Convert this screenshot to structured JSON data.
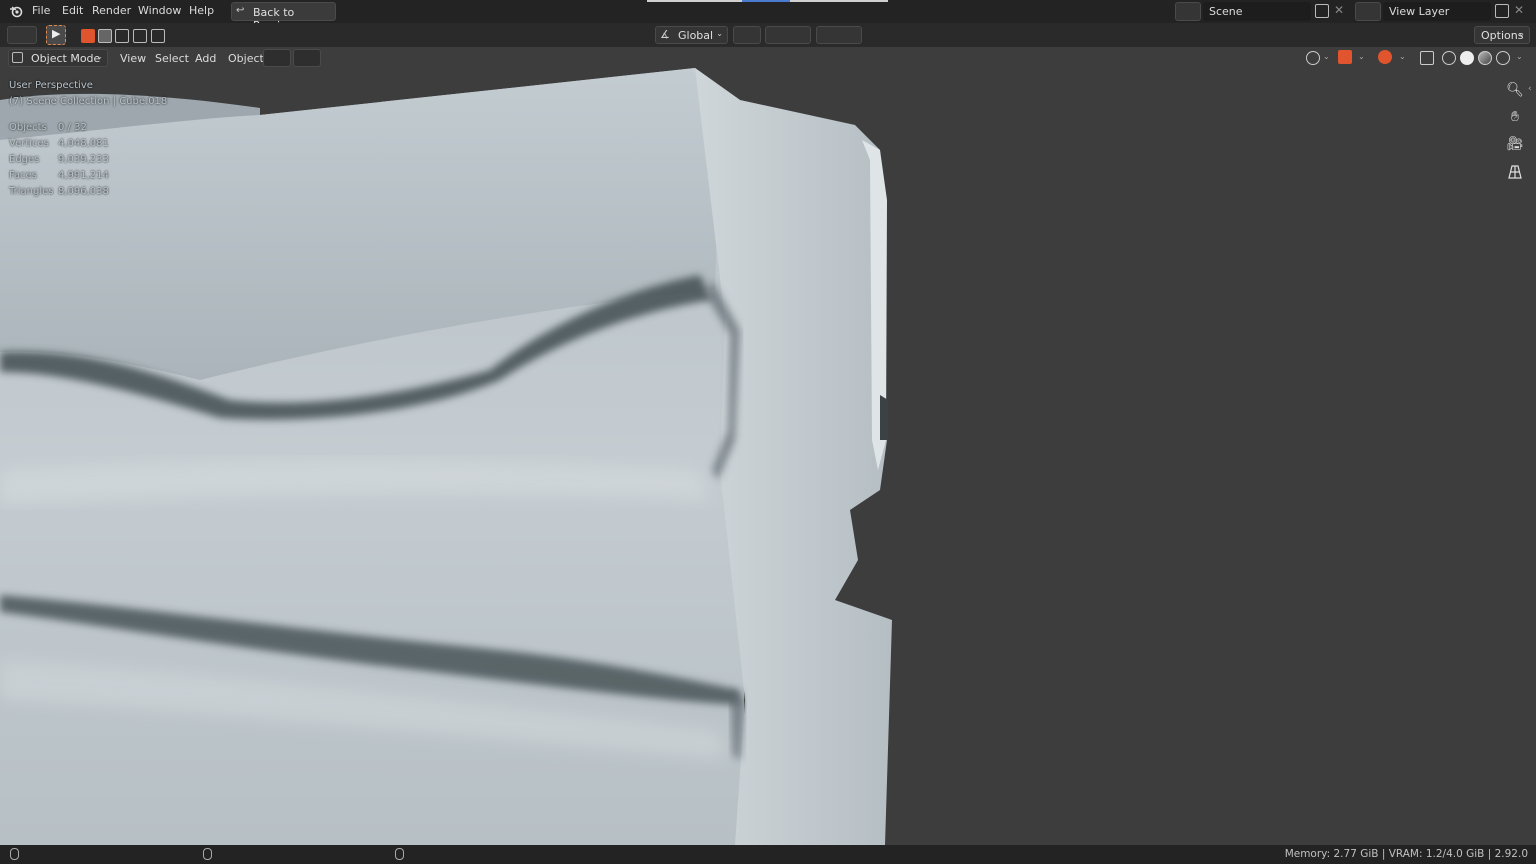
{
  "topbar": {
    "menus": [
      "File",
      "Edit",
      "Render",
      "Window",
      "Help"
    ],
    "back_button": "Back to Previous",
    "scene_field": "Scene",
    "view_layer_field": "View Layer"
  },
  "toolbar": {
    "transform_orientation": "Global",
    "options_label": "Options"
  },
  "viewport_header": {
    "mode": "Object Mode",
    "menus": [
      "View",
      "Select",
      "Add",
      "Object"
    ]
  },
  "overlay": {
    "perspective": "User Perspective",
    "collection": "(7) Scene Collection | Cube.018",
    "stats": [
      {
        "label": "Objects",
        "value": "0 / 32"
      },
      {
        "label": "Vertices",
        "value": "4,048,081"
      },
      {
        "label": "Edges",
        "value": "9,039,233"
      },
      {
        "label": "Faces",
        "value": "4,991,214"
      },
      {
        "label": "Triangles",
        "value": "8,096,038"
      }
    ]
  },
  "navigation_gizmo": [
    "zoom-icon",
    "hand-pan-icon",
    "camera-icon",
    "grid-perspective-icon"
  ],
  "statusbar": {
    "info": "Memory: 2.77 GiB | VRAM: 1.2/4.0 GiB | 2.92.0"
  },
  "colors": {
    "accent": "#e0552e",
    "viewport_bg": "#3d3d3d",
    "mesh": "#bcc4c9"
  }
}
